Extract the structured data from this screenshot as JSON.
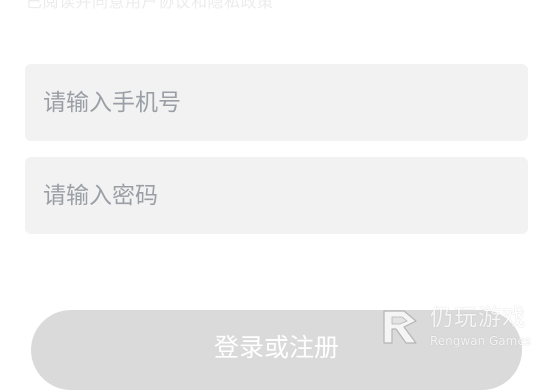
{
  "top_hint": "已阅读并同意用户协议和隐私政策",
  "phone_field": {
    "placeholder": "请输入手机号",
    "value": ""
  },
  "password_field": {
    "placeholder": "请输入密码",
    "value": ""
  },
  "login_button": {
    "label": "登录或注册"
  },
  "watermark": {
    "name_cn": "仍玩游戏",
    "name_en": "Rengwan Games"
  },
  "colors": {
    "field_bg": "#f2f2f2",
    "placeholder": "#9a9fa6",
    "button_bg": "#dadada",
    "button_text": "#ffffff"
  }
}
